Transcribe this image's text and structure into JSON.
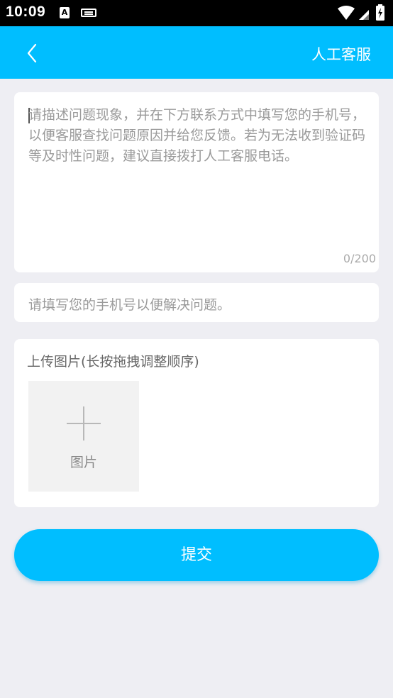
{
  "status_bar": {
    "time": "10:09",
    "notification_letter": "A"
  },
  "header": {
    "title": "人工客服"
  },
  "description": {
    "placeholder": "请描述问题现象，并在下方联系方式中填写您的手机号，以便客服查找问题原因并给您反馈。若为无法收到验证码等及时性问题，建议直接拨打人工客服电话。",
    "counter": "0/200"
  },
  "phone": {
    "placeholder": "请填写您的手机号以便解决问题。"
  },
  "upload": {
    "label": "上传图片(长按拖拽调整顺序)",
    "add_label": "图片"
  },
  "submit_label": "提交",
  "colors": {
    "accent": "#00beff",
    "background": "#eeeef3",
    "placeholder": "#9a9a9a"
  }
}
